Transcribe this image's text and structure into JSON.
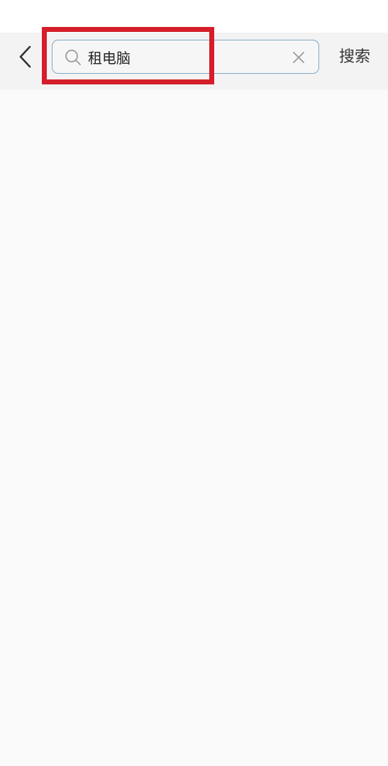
{
  "search": {
    "value": "租电脑",
    "submit_label": "搜索"
  },
  "icons": {
    "back": "chevron-left-icon",
    "search": "search-icon",
    "clear": "close-icon"
  },
  "colors": {
    "search_border": "#7fa8c4",
    "highlight": "#d51e2a",
    "bar_background": "#f3f3f3"
  }
}
